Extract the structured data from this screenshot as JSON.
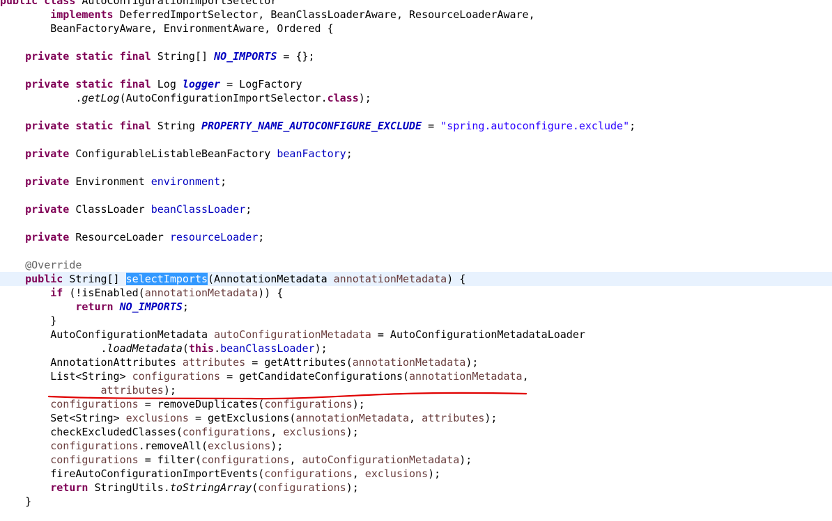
{
  "editor": {
    "lines": [
      [
        [
          "kw",
          "public"
        ],
        [
          "plain",
          " "
        ],
        [
          "kw",
          "class"
        ],
        [
          "plain",
          " AutoConfigurationImportSelector"
        ]
      ],
      [
        [
          "plain",
          "        "
        ],
        [
          "kw",
          "implements"
        ],
        [
          "plain",
          " DeferredImportSelector, BeanClassLoaderAware, ResourceLoaderAware,"
        ]
      ],
      [
        [
          "plain",
          "        BeanFactoryAware, EnvironmentAware, Ordered {"
        ]
      ],
      [],
      [
        [
          "plain",
          "    "
        ],
        [
          "kw",
          "private"
        ],
        [
          "plain",
          " "
        ],
        [
          "kw",
          "static"
        ],
        [
          "plain",
          " "
        ],
        [
          "kw",
          "final"
        ],
        [
          "plain",
          " String[] "
        ],
        [
          "sfield",
          "NO_IMPORTS"
        ],
        [
          "plain",
          " = {};"
        ]
      ],
      [],
      [
        [
          "plain",
          "    "
        ],
        [
          "kw",
          "private"
        ],
        [
          "plain",
          " "
        ],
        [
          "kw",
          "static"
        ],
        [
          "plain",
          " "
        ],
        [
          "kw",
          "final"
        ],
        [
          "plain",
          " Log "
        ],
        [
          "sfield",
          "logger"
        ],
        [
          "plain",
          " = LogFactory"
        ]
      ],
      [
        [
          "plain",
          "            ."
        ],
        [
          "smethod",
          "getLog"
        ],
        [
          "plain",
          "(AutoConfigurationImportSelector."
        ],
        [
          "kw",
          "class"
        ],
        [
          "plain",
          ");"
        ]
      ],
      [],
      [
        [
          "plain",
          "    "
        ],
        [
          "kw",
          "private"
        ],
        [
          "plain",
          " "
        ],
        [
          "kw",
          "static"
        ],
        [
          "plain",
          " "
        ],
        [
          "kw",
          "final"
        ],
        [
          "plain",
          " String "
        ],
        [
          "sfield",
          "PROPERTY_NAME_AUTOCONFIGURE_EXCLUDE"
        ],
        [
          "plain",
          " = "
        ],
        [
          "str",
          "\"spring.autoconfigure.exclude\""
        ],
        [
          "plain",
          ";"
        ]
      ],
      [],
      [
        [
          "plain",
          "    "
        ],
        [
          "kw",
          "private"
        ],
        [
          "plain",
          " ConfigurableListableBeanFactory "
        ],
        [
          "field",
          "beanFactory"
        ],
        [
          "plain",
          ";"
        ]
      ],
      [],
      [
        [
          "plain",
          "    "
        ],
        [
          "kw",
          "private"
        ],
        [
          "plain",
          " Environment "
        ],
        [
          "field",
          "environment"
        ],
        [
          "plain",
          ";"
        ]
      ],
      [],
      [
        [
          "plain",
          "    "
        ],
        [
          "kw",
          "private"
        ],
        [
          "plain",
          " ClassLoader "
        ],
        [
          "field",
          "beanClassLoader"
        ],
        [
          "plain",
          ";"
        ]
      ],
      [],
      [
        [
          "plain",
          "    "
        ],
        [
          "kw",
          "private"
        ],
        [
          "plain",
          " ResourceLoader "
        ],
        [
          "field",
          "resourceLoader"
        ],
        [
          "plain",
          ";"
        ]
      ],
      [],
      [
        [
          "plain",
          "    "
        ],
        [
          "ann",
          "@Override"
        ]
      ],
      [
        [
          "plain",
          "    "
        ],
        [
          "kw",
          "public"
        ],
        [
          "plain",
          " String[] "
        ],
        [
          "sel",
          "selectImports"
        ],
        [
          "plain",
          "(AnnotationMetadata "
        ],
        [
          "local",
          "annotationMetadata"
        ],
        [
          "plain",
          ") {"
        ]
      ],
      [
        [
          "plain",
          "        "
        ],
        [
          "kw",
          "if"
        ],
        [
          "plain",
          " (!isEnabled("
        ],
        [
          "local",
          "annotationMetadata"
        ],
        [
          "plain",
          ")) {"
        ]
      ],
      [
        [
          "plain",
          "            "
        ],
        [
          "kw",
          "return"
        ],
        [
          "plain",
          " "
        ],
        [
          "sfield",
          "NO_IMPORTS"
        ],
        [
          "plain",
          ";"
        ]
      ],
      [
        [
          "plain",
          "        }"
        ]
      ],
      [
        [
          "plain",
          "        AutoConfigurationMetadata "
        ],
        [
          "local",
          "autoConfigurationMetadata"
        ],
        [
          "plain",
          " = AutoConfigurationMetadataLoader"
        ]
      ],
      [
        [
          "plain",
          "                ."
        ],
        [
          "smethod",
          "loadMetadata"
        ],
        [
          "plain",
          "("
        ],
        [
          "kw",
          "this"
        ],
        [
          "plain",
          "."
        ],
        [
          "field",
          "beanClassLoader"
        ],
        [
          "plain",
          ");"
        ]
      ],
      [
        [
          "plain",
          "        AnnotationAttributes "
        ],
        [
          "local",
          "attributes"
        ],
        [
          "plain",
          " = getAttributes("
        ],
        [
          "local",
          "annotationMetadata"
        ],
        [
          "plain",
          ");"
        ]
      ],
      [
        [
          "plain",
          "        List<String> "
        ],
        [
          "local",
          "configurations"
        ],
        [
          "plain",
          " = getCandidateConfigurations("
        ],
        [
          "local",
          "annotationMetadata"
        ],
        [
          "plain",
          ","
        ]
      ],
      [
        [
          "plain",
          "                "
        ],
        [
          "local",
          "attributes"
        ],
        [
          "plain",
          ");"
        ]
      ],
      [
        [
          "plain",
          "        "
        ],
        [
          "local",
          "configurations"
        ],
        [
          "plain",
          " = removeDuplicates("
        ],
        [
          "local",
          "configurations"
        ],
        [
          "plain",
          ");"
        ]
      ],
      [
        [
          "plain",
          "        Set<String> "
        ],
        [
          "local",
          "exclusions"
        ],
        [
          "plain",
          " = getExclusions("
        ],
        [
          "local",
          "annotationMetadata"
        ],
        [
          "plain",
          ", "
        ],
        [
          "local",
          "attributes"
        ],
        [
          "plain",
          ");"
        ]
      ],
      [
        [
          "plain",
          "        checkExcludedClasses("
        ],
        [
          "local",
          "configurations"
        ],
        [
          "plain",
          ", "
        ],
        [
          "local",
          "exclusions"
        ],
        [
          "plain",
          ");"
        ]
      ],
      [
        [
          "plain",
          "        "
        ],
        [
          "local",
          "configurations"
        ],
        [
          "plain",
          ".removeAll("
        ],
        [
          "local",
          "exclusions"
        ],
        [
          "plain",
          ");"
        ]
      ],
      [
        [
          "plain",
          "        "
        ],
        [
          "local",
          "configurations"
        ],
        [
          "plain",
          " = filter("
        ],
        [
          "local",
          "configurations"
        ],
        [
          "plain",
          ", "
        ],
        [
          "local",
          "autoConfigurationMetadata"
        ],
        [
          "plain",
          ");"
        ]
      ],
      [
        [
          "plain",
          "        fireAutoConfigurationImportEvents("
        ],
        [
          "local",
          "configurations"
        ],
        [
          "plain",
          ", "
        ],
        [
          "local",
          "exclusions"
        ],
        [
          "plain",
          ");"
        ]
      ],
      [
        [
          "plain",
          "        "
        ],
        [
          "kw",
          "return"
        ],
        [
          "plain",
          " StringUtils."
        ],
        [
          "smethod",
          "toStringArray"
        ],
        [
          "plain",
          "("
        ],
        [
          "local",
          "configurations"
        ],
        [
          "plain",
          ");"
        ]
      ],
      [
        [
          "plain",
          "    }"
        ]
      ]
    ],
    "current_line": 20,
    "colors": {
      "keyword": "#7f0055",
      "field": "#0000c0",
      "string": "#2a00ff",
      "local_variable": "#6a3e3e",
      "annotation": "#646464",
      "selection": "#3399ff",
      "current_line_bg": "#e8f2fe",
      "handwritten_underline": "#e00000"
    }
  }
}
